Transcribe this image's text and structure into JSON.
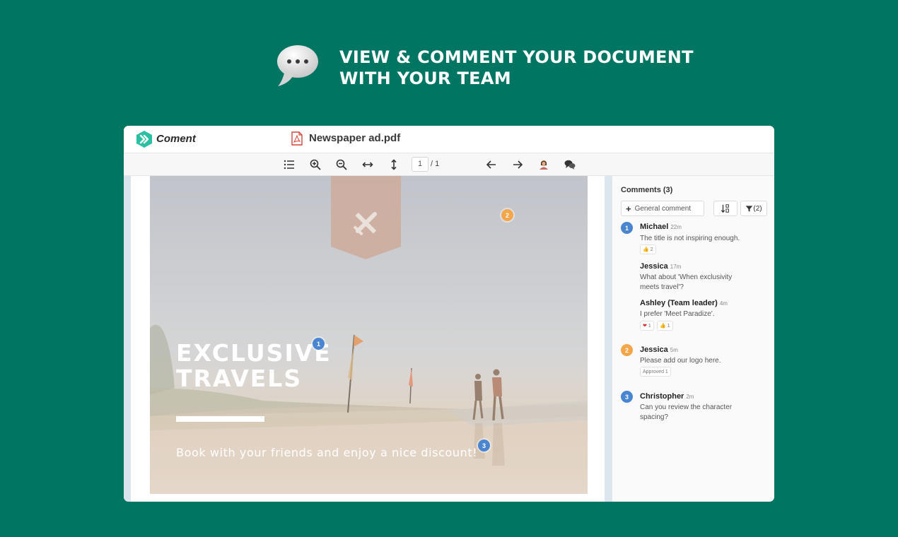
{
  "hero": {
    "icon": "speech-bubble-icon",
    "title_line1": "VIEW & COMMENT YOUR DOCUMENT",
    "title_line2": "WITH YOUR TEAM"
  },
  "app": {
    "brand": "Coment",
    "brand_color": "#2bbfa4",
    "file_name": "Newspaper ad.pdf",
    "file_icon": "pdf-file-icon",
    "toolbar": {
      "icons": [
        "list-icon",
        "zoom-in-icon",
        "zoom-out-icon",
        "fit-width-icon",
        "fit-height-icon",
        "arrow-left-icon",
        "arrow-right-icon",
        "user-icon",
        "comments-icon"
      ],
      "page_current": "1",
      "page_total": "/ 1"
    },
    "document": {
      "headline_line1": "EXCLUSIVE",
      "headline_line2": "TRAVELS",
      "subline": "Book with your friends and enjoy a nice discount!",
      "pins": [
        {
          "label": "1",
          "color": "#4a85d2"
        },
        {
          "label": "2",
          "color": "#f5a54a"
        },
        {
          "label": "3",
          "color": "#4a85d2"
        }
      ]
    },
    "comments": {
      "title": "Comments (3)",
      "general_button": "General comment",
      "filter_count": "(2)",
      "threads": [
        {
          "number": "1",
          "author": "Michael",
          "time": "22m",
          "text": "The title is not inspiring enough.",
          "reactions": [
            {
              "emoji": "👍",
              "count": "2"
            }
          ],
          "replies": [
            {
              "author": "Jessica",
              "time": "17m",
              "text": "What about 'When exclusivity meets travel'?"
            },
            {
              "author": "Ashley (Team leader)",
              "time": "4m",
              "text": "I prefer 'Meet Paradize'.",
              "reactions": [
                {
                  "emoji": "❤",
                  "count": "1"
                },
                {
                  "emoji": "👍",
                  "count": "1"
                }
              ]
            }
          ]
        },
        {
          "number": "2",
          "author": "Jessica",
          "time": "5m",
          "text": "Please add our logo here.",
          "tag": "Approved 1"
        },
        {
          "number": "3",
          "author": "Christopher",
          "time": "2m",
          "text": "Can you review the character spacing?"
        }
      ]
    }
  }
}
